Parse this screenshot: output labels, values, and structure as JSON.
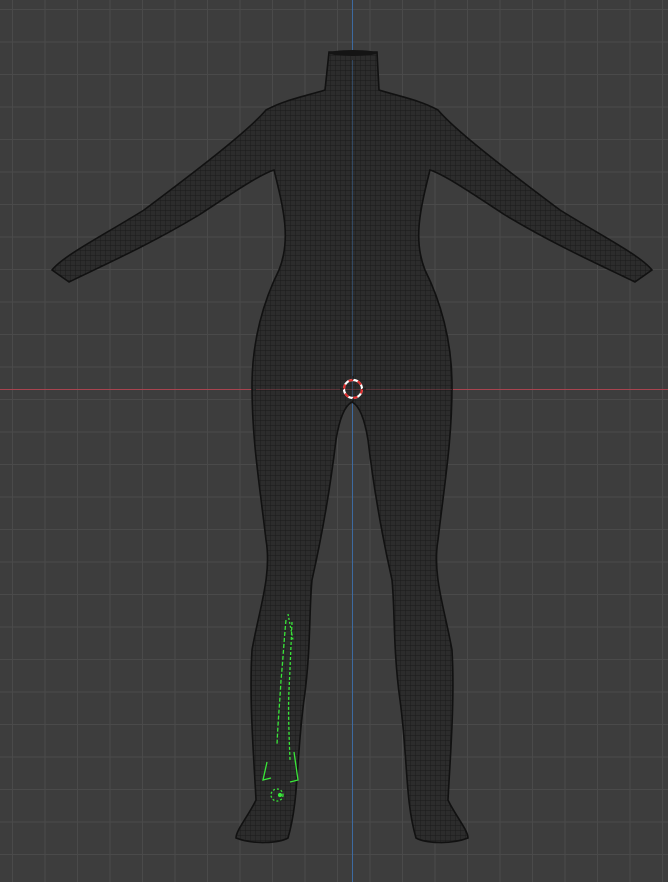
{
  "viewport": {
    "view": "front-orthographic",
    "shading": "wireframe",
    "grid": true,
    "background_color": "#3d3d3d",
    "grid_color": "#4a4a4a",
    "mesh_fill_color": "#2c2c2c",
    "mesh_wire_color": "#1a1a1a",
    "x_axis_color": "#a8434f",
    "z_axis_color": "#3d6aa0",
    "selection_color": "#39e639",
    "cursor_colors": [
      "#e03030",
      "#ffffff"
    ],
    "icons": [
      "3d-cursor-icon"
    ]
  }
}
